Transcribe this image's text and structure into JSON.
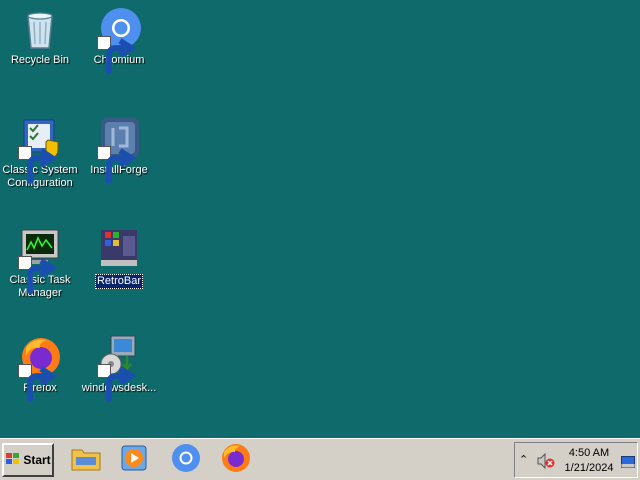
{
  "desktop": {
    "icons": [
      {
        "label": "Recycle Bin",
        "icon": "recycle-bin-icon"
      },
      {
        "label": "Chromium",
        "icon": "chromium-icon"
      },
      {
        "label": "Classic System Configuration",
        "icon": "system-configuration-icon"
      },
      {
        "label": "InstallForge",
        "icon": "installforge-icon"
      },
      {
        "label": "Classic Task Manager",
        "icon": "task-manager-icon"
      },
      {
        "label": "RetroBar",
        "icon": "retrobar-icon",
        "selected": true
      },
      {
        "label": "Firefox",
        "icon": "firefox-icon"
      },
      {
        "label": "windowsdesk...",
        "icon": "installer-icon"
      }
    ]
  },
  "taskbar": {
    "start_label": "Start",
    "quick_launch": [
      "file-explorer-icon",
      "media-player-icon",
      "chromium-icon",
      "firefox-icon"
    ],
    "tray": {
      "chevron": "⌃",
      "volume_icon": "volume-muted-icon",
      "time": "4:50 AM",
      "date": "1/21/2024",
      "show_desktop_icon": "show-desktop-icon"
    }
  },
  "colors": {
    "desktop": "#0f6b6b",
    "taskbar": "#d4d0c8",
    "selection": "#0a246a"
  }
}
